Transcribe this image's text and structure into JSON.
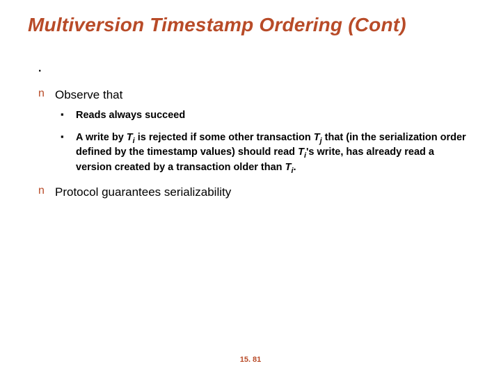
{
  "title": "Multiversion Timestamp Ordering (Cont)",
  "dot": ".",
  "bullets": {
    "n": "n",
    "square": "▪"
  },
  "items": [
    {
      "text": "Observe that",
      "sub": [
        {
          "html": "Reads always succeed"
        },
        {
          "html": "A write by <span class='sub-i'>T</span><span class='sub-s'>i</span> is rejected if some other transaction <span class='sub-i'>T</span><span class='sub-s'>j</span> that (in the serialization order defined by the timestamp values) should read <span class='sub-i'>T</span><span class='sub-s'>i</span>'s write, has already read a version created by a transaction older than <span class='sub-i'>T</span><span class='sub-s'>i</span>."
        }
      ]
    },
    {
      "text": "Protocol guarantees serializability",
      "sub": []
    }
  ],
  "pagenum": "15. 81"
}
